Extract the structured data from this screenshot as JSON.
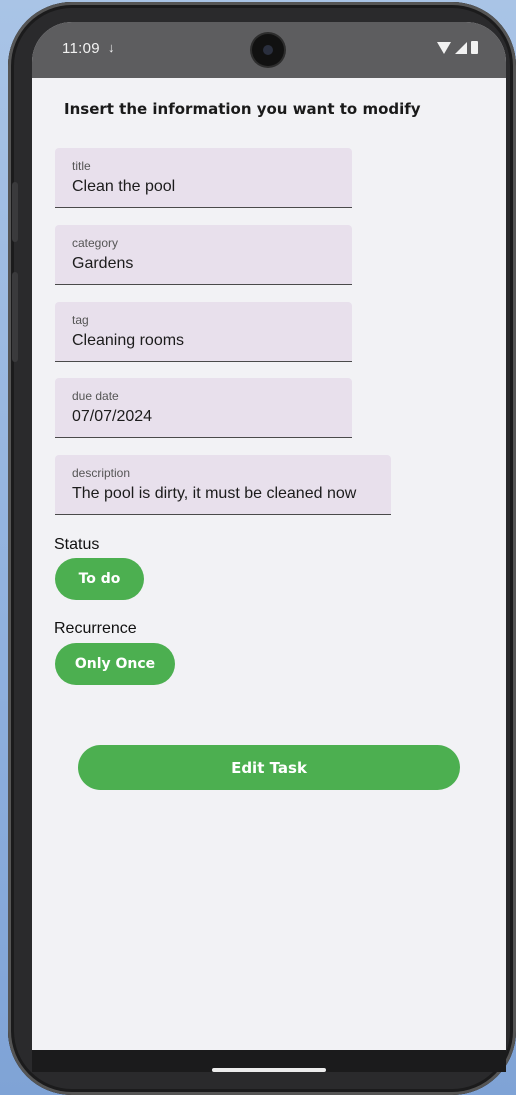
{
  "status_bar": {
    "time": "11:09",
    "download_icon": "download-icon",
    "camera_icon": "camera-icon",
    "wifi_icon": "wifi-icon",
    "signal_icon": "signal-icon",
    "battery_icon": "battery-icon"
  },
  "page": {
    "title": "Insert the information you want to modify"
  },
  "fields": {
    "title": {
      "label": "title",
      "value": "Clean the pool"
    },
    "category": {
      "label": "category",
      "value": "Gardens"
    },
    "tag": {
      "label": "tag",
      "value": "Cleaning rooms"
    },
    "due_date": {
      "label": "due date",
      "value": "07/07/2024"
    },
    "description": {
      "label": "description",
      "value": "The pool is dirty, it must be cleaned now"
    }
  },
  "status": {
    "label": "Status",
    "chip": "To do"
  },
  "recurrence": {
    "label": "Recurrence",
    "chip": "Only Once"
  },
  "actions": {
    "edit_label": "Edit Task"
  },
  "colors": {
    "accent": "#4caf50",
    "field_bg": "#e8e0ec",
    "screen_bg": "#f2f2f5"
  }
}
